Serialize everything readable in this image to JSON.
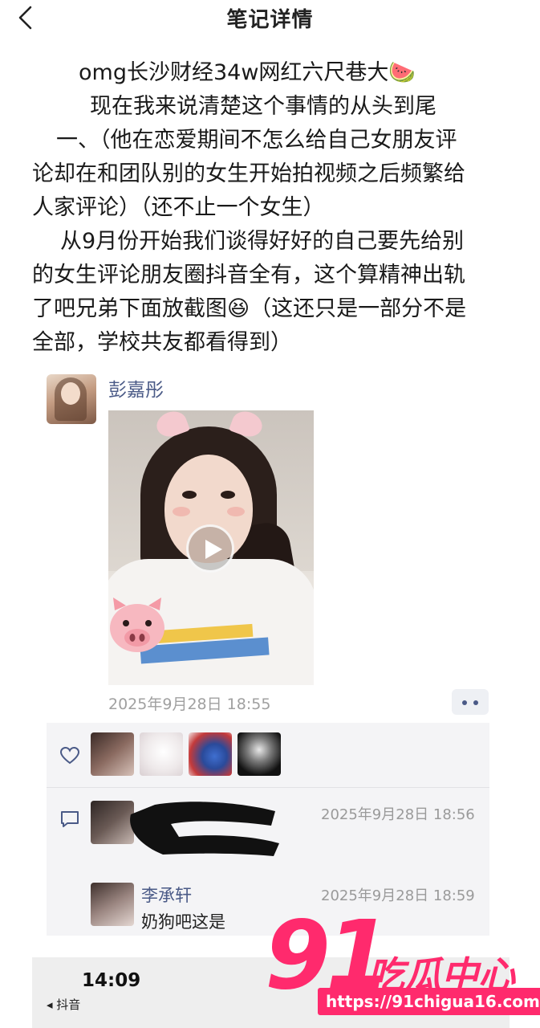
{
  "header": {
    "title": "笔记详情",
    "back_icon": "chevron-left-icon"
  },
  "post": {
    "lines": [
      "omg长沙财经34w网红六尺巷大🍉",
      "现在我来说清楚这个事情的从头到尾",
      "一、（他在恋爱期间不怎么给自己女朋友评",
      "论却在和团队别的女生开始拍视频之后频繁给",
      "人家评论）（还不止一个女生）",
      "从9月份开始我们谈得好好的自己要先给别",
      "的女生评论朋友圈抖音全有，这个算精神出轨",
      "了吧兄弟下面放截图😆（这还只是一部分不是",
      "全部，学校共友都看得到）"
    ]
  },
  "moment": {
    "author": "彭嘉彤",
    "time": "2025年9月28日 18:55",
    "media_icon": "play-icon",
    "sticker_icon": "pig-face-icon",
    "likes_icon": "heart-outline-icon",
    "comments_icon": "comment-icon",
    "comments": [
      {
        "name": "",
        "time": "2025年9月28日 18:56",
        "text": ""
      },
      {
        "name": "李承轩",
        "time": "2025年9月28日 18:59",
        "text": "奶狗吧这是"
      }
    ]
  },
  "embedded_screenshot": {
    "clock": "14:09",
    "back_label": "◂ 抖音"
  },
  "watermark": {
    "number": "91",
    "name": "吃瓜中心",
    "url": "https://91chigua16.com",
    "color": "#ff2a6d"
  },
  "colors": {
    "link_name": "#4a5a87",
    "timestamp": "#a0a0a0",
    "panel_bg": "#f4f4f6"
  }
}
